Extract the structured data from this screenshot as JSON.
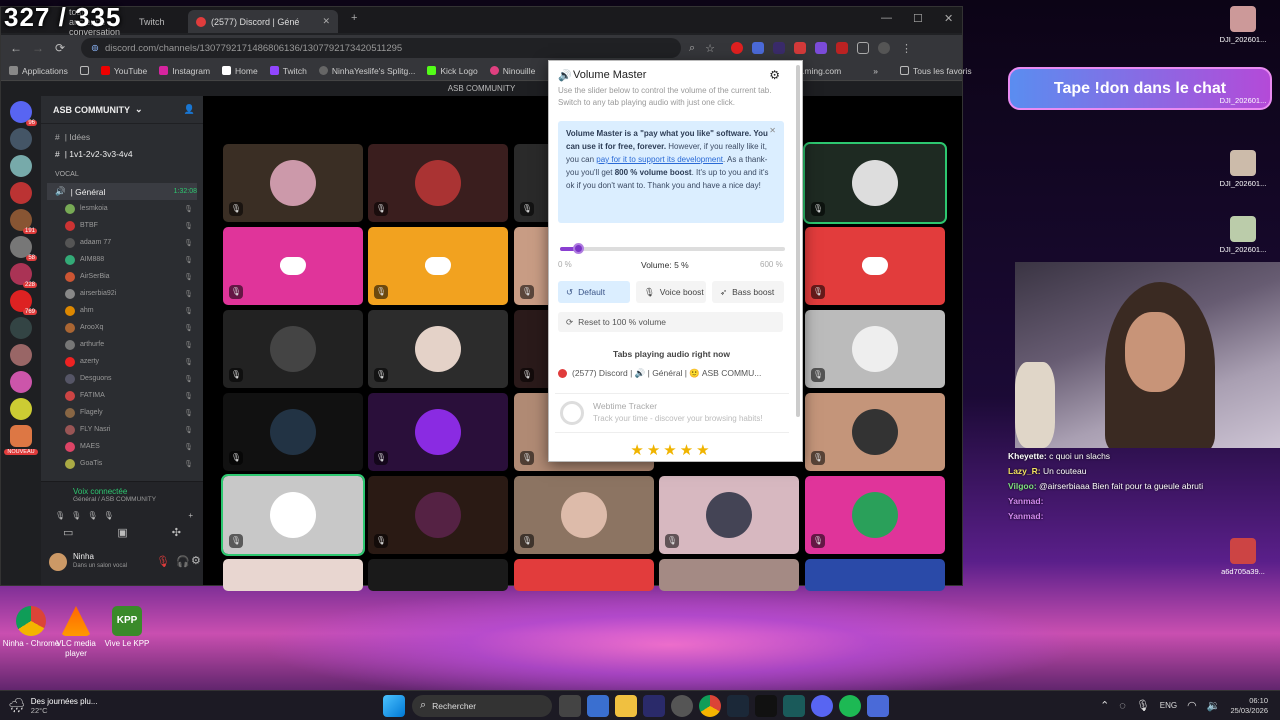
{
  "counter": "327 / 335",
  "browser": {
    "tabs": [
      {
        "label": "tout ancienne conversation"
      },
      {
        "label": "Twitch"
      },
      {
        "label": "(2577) Discord | Géné"
      }
    ],
    "new_tab": "+",
    "url": "discord.com/channels/1307792171486806136/1307792173420511295",
    "bookmarks": [
      "Applications",
      "YouTube",
      "Instagram",
      "Home",
      "Twitch",
      "NinhaYeslife's Splitg...",
      "Kick Logo",
      "Ninouille",
      "...ming.com"
    ],
    "all_favorites": "Tous les favoris"
  },
  "discord": {
    "window_title": "ASB COMMUNITY",
    "server_name": "ASB COMMUNITY",
    "server_badges": [
      "96",
      "191",
      "58",
      "228",
      "769"
    ],
    "new_badge": "NOUVEAU",
    "channels": [
      {
        "label": "| Idées"
      },
      {
        "label": "| 1v1-2v2-3v3-4v4"
      }
    ],
    "category": "VOCAL",
    "voice_channel": "| Général",
    "voice_time": "1:32:08",
    "users": [
      "lesmkoia",
      "BTBF",
      "adaam 77",
      "AIM888",
      "AirSerBia",
      "airserbia92i",
      "ahm",
      "ArooXq",
      "arthurfe",
      "azerty",
      "Desguons",
      "FATIMA",
      "Flagely",
      "FLY Nasri",
      "MAES",
      "GoaTis"
    ],
    "voice_connected": "Voix connectée",
    "voice_location": "Général / ASB COMMUNITY",
    "username": "Ninha",
    "user_status": "Dans un salon vocal"
  },
  "popup": {
    "title": "Volume Master",
    "subtitle": "Use the slider below to control the volume of the current tab. Switch to any tab playing audio with just one click.",
    "note_bold": "Volume Master is a \"pay what you like\" software. You can use it for free, forever.",
    "note_1": "However, if you really like it, you can",
    "note_link": "pay for it to support its development",
    "note_2": ". As a thank-you you'll get",
    "note_boost": "800 % volume boost",
    "note_3": ". It's up to you and it's ok if you don't want to. Thank you and have a nice day!",
    "min_label": "0 %",
    "max_label": "600 %",
    "volume_label": "Volume: 5 %",
    "volume_value": 5,
    "volume_max": 600,
    "buttons": {
      "default": "Default",
      "voice": "Voice boost",
      "bass": "Bass boost"
    },
    "reset": "Reset to 100 % volume",
    "tabs_header": "Tabs playing audio right now",
    "tab_entry": "(2577) Discord | 🔊 | Général | 🙂 ASB COMMU...",
    "webtime_title": "Webtime Tracker",
    "webtime_desc": "Track your time - discover your browsing habits!",
    "stars": "★★★★★",
    "accent_color": "#7b34c6"
  },
  "overlay": {
    "don_text": "Tape !don dans le chat",
    "files": [
      "DJI_202601...",
      "DJI_202601...",
      "DJI_202601...",
      "DJI_202601...",
      "a6d705a39..."
    ],
    "chat": [
      {
        "user": "Kheyette:",
        "msg": "c quoi un slachs",
        "color": "#ffffff"
      },
      {
        "user": "Lazy_R:",
        "msg": "Un couteau",
        "color": "#f0e060"
      },
      {
        "user": "Vilgoo:",
        "msg": "@airserbiaaa Bien fait pour ta gueule abruti",
        "color": "#7ee07e"
      },
      {
        "user": "Yanmad:",
        "msg": "",
        "color": "#d38af0"
      },
      {
        "user": "Yanmad:",
        "msg": "",
        "color": "#d38af0"
      }
    ]
  },
  "desktop": {
    "icons": [
      "Ninha - Chrome",
      "VLC media player",
      "Vive Le KPP"
    ],
    "kpp_logo": "KPP"
  },
  "taskbar": {
    "weather_title": "Des journées plu...",
    "weather_temp": "22°C",
    "search": "Rechercher",
    "lang": "ENG",
    "time": "06:10",
    "date": "25/03/2026"
  }
}
